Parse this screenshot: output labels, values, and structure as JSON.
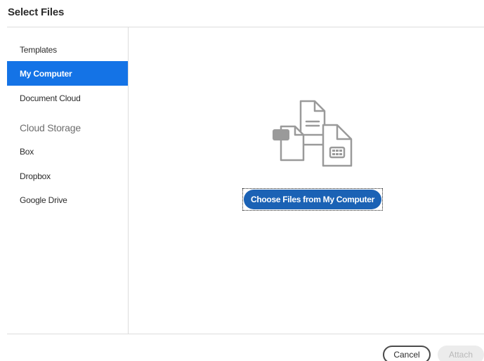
{
  "dialog": {
    "title": "Select Files"
  },
  "sidebar": {
    "items": [
      {
        "label": "Templates",
        "selected": false
      },
      {
        "label": "My Computer",
        "selected": true
      },
      {
        "label": "Document Cloud",
        "selected": false
      }
    ],
    "cloud_heading": "Cloud Storage",
    "cloud_items": [
      {
        "label": "Box"
      },
      {
        "label": "Dropbox"
      },
      {
        "label": "Google Drive"
      }
    ]
  },
  "main": {
    "illustration_icon": "files-stack-icon",
    "choose_button_label": "Choose Files from My Computer"
  },
  "footer": {
    "cancel_label": "Cancel",
    "attach_label": "Attach",
    "attach_enabled": false
  },
  "colors": {
    "accent": "#1473e6",
    "primary_button": "#1b62b5",
    "divider": "#dcdcdc",
    "disabled_bg": "#ececec",
    "disabled_text": "#b9b9b9",
    "icon_gray": "#9a9a9a"
  }
}
